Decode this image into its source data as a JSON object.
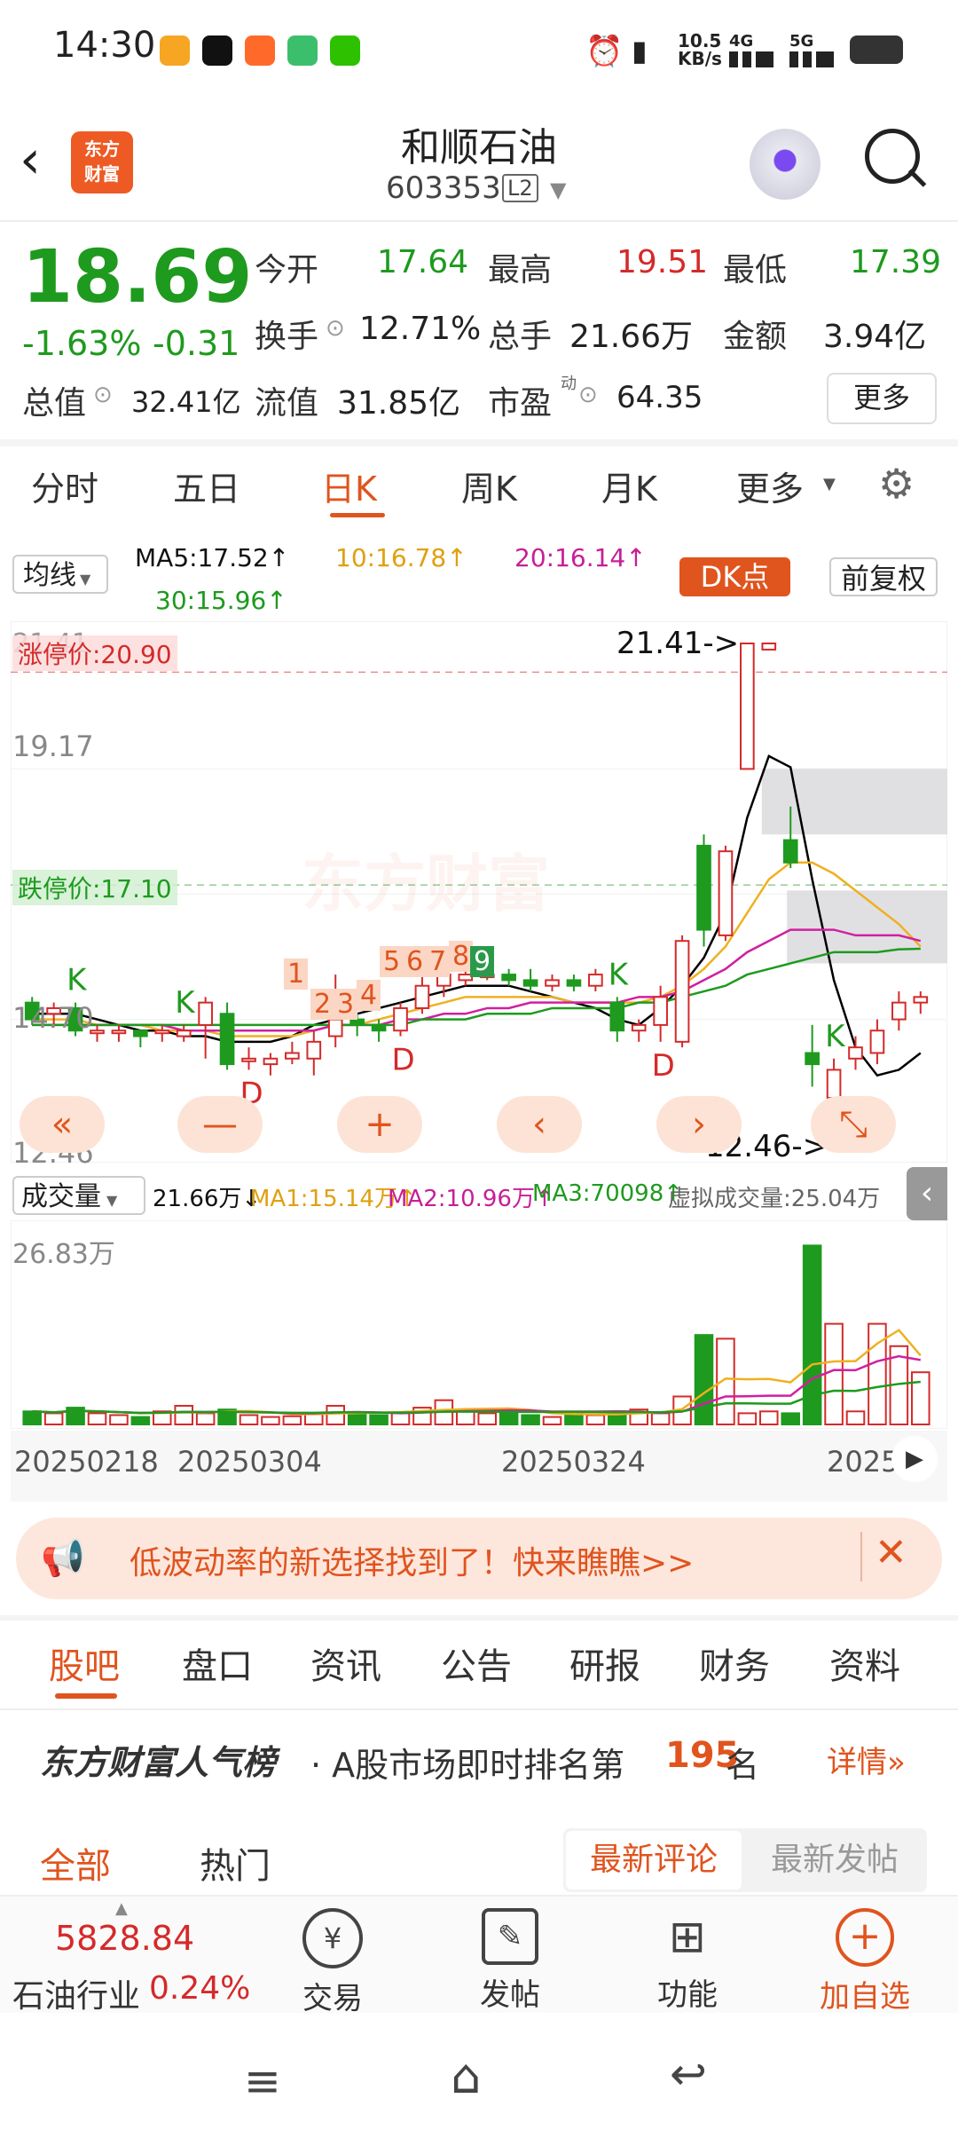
{
  "status_bar": {
    "time": "14:30",
    "net_speed_top": "10.5",
    "net_speed_unit": "KB/s",
    "sig1": "4G",
    "sig2": "5G"
  },
  "header": {
    "logo_line1": "东方",
    "logo_line2": "财富",
    "stock_name": "和顺石油",
    "stock_code": "603353",
    "level_badge": "L2"
  },
  "quote": {
    "price": "18.69",
    "change_pct": "-1.63%",
    "change_amt": "-0.31",
    "open_label": "今开",
    "open": "17.64",
    "high_label": "最高",
    "high": "19.51",
    "low_label": "最低",
    "low": "17.39",
    "turnover_label": "换手",
    "turnover": "12.71%",
    "volume_label": "总手",
    "volume": "21.66万",
    "amount_label": "金额",
    "amount": "3.94亿",
    "mktcap_label": "总值",
    "mktcap": "32.41亿",
    "float_label": "流值",
    "float_cap": "31.85亿",
    "pe_label": "市盈",
    "pe_sup": "动",
    "pe": "64.35",
    "more": "更多"
  },
  "period_tabs": [
    "分时",
    "五日",
    "日K",
    "周K",
    "月K",
    "更多"
  ],
  "indicator": {
    "ma_select": "均线",
    "ma5": "MA5:17.52↑",
    "ma10": "10:16.78↑",
    "ma20": "20:16.14↑",
    "ma30": "30:15.96↑",
    "dk_label": "DK点",
    "fq_label": "前复权"
  },
  "kchart": {
    "y_top": "21.41",
    "y_mid": "19.17",
    "y_lowmid": "14.70",
    "y_bottom": "12.46",
    "limit_up": "涨停价:20.90",
    "limit_down": "跌停价:17.10",
    "max_callout": "21.41->",
    "min_callout": "12.46->",
    "watermark": "东方财富",
    "seq": [
      "1",
      "2",
      "3",
      "4",
      "5",
      "6",
      "7",
      "8",
      "9"
    ]
  },
  "volume": {
    "select": "成交量",
    "vol": "21.66万↓",
    "ma1": "MA1:15.14万↑",
    "ma2": "MA2:10.96万↑",
    "ma3": "MA3:70098↑",
    "virtual": "虚拟成交量:25.04万",
    "y_top": "26.83万",
    "dates": [
      "20250218",
      "20250304",
      "20250324",
      "2025"
    ]
  },
  "chart_data": {
    "type": "candlestick",
    "title": "",
    "ylim": [
      12.46,
      21.41
    ],
    "candles": [
      {
        "o": 15.0,
        "c": 14.7,
        "h": 15.1,
        "l": 14.6
      },
      {
        "o": 14.8,
        "c": 14.9,
        "h": 15.0,
        "l": 14.6
      },
      {
        "o": 14.9,
        "c": 14.5,
        "h": 15.0,
        "l": 14.4
      },
      {
        "o": 14.5,
        "c": 14.5,
        "h": 14.6,
        "l": 14.3
      },
      {
        "o": 14.5,
        "c": 14.5,
        "h": 14.6,
        "l": 14.3
      },
      {
        "o": 14.5,
        "c": 14.4,
        "h": 14.5,
        "l": 14.2
      },
      {
        "o": 14.5,
        "c": 14.5,
        "h": 14.6,
        "l": 14.3
      },
      {
        "o": 14.4,
        "c": 14.5,
        "h": 14.6,
        "l": 14.3
      },
      {
        "o": 14.6,
        "c": 15.0,
        "h": 15.1,
        "l": 14.0
      },
      {
        "o": 14.8,
        "c": 13.9,
        "h": 15.0,
        "l": 13.8
      },
      {
        "o": 14.0,
        "c": 14.0,
        "h": 14.2,
        "l": 13.8
      },
      {
        "o": 13.9,
        "c": 14.0,
        "h": 14.1,
        "l": 13.7
      },
      {
        "o": 14.0,
        "c": 14.1,
        "h": 14.3,
        "l": 13.9
      },
      {
        "o": 14.0,
        "c": 14.3,
        "h": 14.5,
        "l": 13.7
      },
      {
        "o": 14.4,
        "c": 14.7,
        "h": 15.5,
        "l": 14.2
      },
      {
        "o": 14.7,
        "c": 14.6,
        "h": 14.8,
        "l": 14.4
      },
      {
        "o": 14.6,
        "c": 14.5,
        "h": 14.7,
        "l": 14.3
      },
      {
        "o": 14.5,
        "c": 14.9,
        "h": 15.0,
        "l": 14.4
      },
      {
        "o": 14.9,
        "c": 15.3,
        "h": 15.6,
        "l": 14.8
      },
      {
        "o": 15.3,
        "c": 15.5,
        "h": 15.7,
        "l": 15.1
      },
      {
        "o": 15.4,
        "c": 15.5,
        "h": 15.6,
        "l": 15.3
      },
      {
        "o": 15.5,
        "c": 15.5,
        "h": 15.6,
        "l": 15.4
      },
      {
        "o": 15.5,
        "c": 15.4,
        "h": 15.6,
        "l": 15.3
      },
      {
        "o": 15.4,
        "c": 15.3,
        "h": 15.6,
        "l": 15.2
      },
      {
        "o": 15.3,
        "c": 15.4,
        "h": 15.5,
        "l": 15.2
      },
      {
        "o": 15.4,
        "c": 15.3,
        "h": 15.5,
        "l": 15.2
      },
      {
        "o": 15.3,
        "c": 15.5,
        "h": 15.6,
        "l": 15.2
      },
      {
        "o": 15.0,
        "c": 14.5,
        "h": 15.1,
        "l": 14.3
      },
      {
        "o": 14.5,
        "c": 14.6,
        "h": 14.7,
        "l": 14.3
      },
      {
        "o": 14.6,
        "c": 15.1,
        "h": 15.3,
        "l": 14.3
      },
      {
        "o": 14.3,
        "c": 16.1,
        "h": 16.2,
        "l": 14.2
      },
      {
        "o": 17.8,
        "c": 16.3,
        "h": 18.0,
        "l": 16.0
      },
      {
        "o": 16.2,
        "c": 17.7,
        "h": 17.8,
        "l": 16.1
      },
      {
        "o": 19.17,
        "c": 21.41,
        "h": 21.41,
        "l": 19.17
      },
      {
        "o": 21.3,
        "c": 21.41,
        "h": 21.41,
        "l": 21.3
      },
      {
        "o": 17.9,
        "c": 17.5,
        "h": 18.5,
        "l": 17.4
      },
      {
        "o": 14.1,
        "c": 13.9,
        "h": 14.6,
        "l": 13.5
      },
      {
        "o": 13.3,
        "c": 13.8,
        "h": 14.0,
        "l": 12.46
      },
      {
        "o": 14.0,
        "c": 14.2,
        "h": 14.4,
        "l": 13.8
      },
      {
        "o": 14.1,
        "c": 14.5,
        "h": 14.7,
        "l": 13.9
      },
      {
        "o": 14.7,
        "c": 15.0,
        "h": 15.2,
        "l": 14.5
      },
      {
        "o": 15.0,
        "c": 15.1,
        "h": 15.2,
        "l": 14.8
      }
    ],
    "volumes": [
      0.35,
      0.3,
      0.45,
      0.3,
      0.25,
      0.2,
      0.35,
      0.5,
      0.3,
      0.4,
      0.25,
      0.2,
      0.22,
      0.3,
      0.5,
      0.3,
      0.25,
      0.3,
      0.45,
      0.65,
      0.4,
      0.3,
      0.35,
      0.25,
      0.2,
      0.3,
      0.25,
      0.35,
      0.4,
      0.3,
      0.75,
      2.4,
      2.3,
      0.3,
      0.35,
      0.3,
      4.8,
      2.7,
      0.35,
      2.7,
      2.1,
      1.4
    ],
    "ma_values": {
      "MA5": [
        14.8,
        14.8,
        14.8,
        14.7,
        14.6,
        14.5,
        14.5,
        14.4,
        14.4,
        14.3,
        14.3,
        14.3,
        14.4,
        14.6,
        14.7,
        14.8,
        14.9,
        15.0,
        15.1,
        15.2,
        15.3,
        15.3,
        15.3,
        15.2,
        15.1,
        15.0,
        14.9,
        14.7,
        14.6,
        14.9,
        15.3,
        15.8,
        16.6,
        18.3,
        19.4,
        19.2,
        17.2,
        15.4,
        14.2,
        13.7,
        13.8,
        14.1
      ],
      "MA10": [
        14.7,
        14.7,
        14.7,
        14.6,
        14.6,
        14.6,
        14.5,
        14.5,
        14.5,
        14.4,
        14.4,
        14.4,
        14.4,
        14.5,
        14.6,
        14.6,
        14.7,
        14.8,
        14.9,
        15.0,
        15.1,
        15.1,
        15.1,
        15.1,
        15.1,
        15.0,
        15.0,
        15.0,
        15.0,
        15.1,
        15.3,
        15.6,
        16.0,
        16.6,
        17.2,
        17.5,
        17.5,
        17.3,
        17.0,
        16.7,
        16.4,
        16.0
      ],
      "MA20": [
        14.6,
        14.6,
        14.6,
        14.6,
        14.6,
        14.6,
        14.6,
        14.5,
        14.5,
        14.5,
        14.5,
        14.5,
        14.5,
        14.5,
        14.6,
        14.6,
        14.6,
        14.7,
        14.7,
        14.8,
        14.8,
        14.9,
        14.9,
        15.0,
        15.0,
        15.0,
        15.0,
        15.0,
        15.1,
        15.1,
        15.2,
        15.4,
        15.6,
        15.9,
        16.1,
        16.3,
        16.3,
        16.3,
        16.2,
        16.2,
        16.2,
        16.1
      ],
      "MA30": [
        14.6,
        14.6,
        14.6,
        14.6,
        14.6,
        14.6,
        14.6,
        14.6,
        14.6,
        14.6,
        14.6,
        14.6,
        14.6,
        14.6,
        14.6,
        14.6,
        14.6,
        14.6,
        14.7,
        14.7,
        14.7,
        14.8,
        14.8,
        14.8,
        14.9,
        14.9,
        14.9,
        14.9,
        15.0,
        15.0,
        15.1,
        15.2,
        15.3,
        15.5,
        15.6,
        15.7,
        15.8,
        15.9,
        15.9,
        15.9,
        15.95,
        15.96
      ]
    }
  },
  "nav_buttons": [
    "«",
    "—",
    "+",
    "‹",
    "›",
    "⤡"
  ],
  "banner": {
    "text": "低波动率的新选择找到了！快来瞧瞧>>"
  },
  "bottom_tabs": [
    "股吧",
    "盘口",
    "资讯",
    "公告",
    "研报",
    "财务",
    "资料"
  ],
  "ranking": {
    "brand": "东方财富人气榜",
    "prefix": "· A股市场即时排名第",
    "rank": "195",
    "suffix": "名",
    "detail": "详情»"
  },
  "filters": {
    "all": "全部",
    "hot": "热门",
    "latest_comment": "最新评论",
    "latest_post": "最新发帖"
  },
  "industry": {
    "value": "5828.84",
    "name": "石油行业",
    "change": "0.24%"
  },
  "bottom_actions": [
    {
      "label": "交易",
      "icon": "yuan-icon"
    },
    {
      "label": "发帖",
      "icon": "edit-icon"
    },
    {
      "label": "功能",
      "icon": "grid-icon"
    },
    {
      "label": "加自选",
      "icon": "plus-circle-icon"
    }
  ],
  "colors": {
    "up": "#d42a2a",
    "down": "#1e9a1e",
    "accent": "#e0541e",
    "ma5": "#000000",
    "ma10": "#f0b020",
    "ma20": "#d020a0",
    "ma30": "#1e9a1e"
  }
}
